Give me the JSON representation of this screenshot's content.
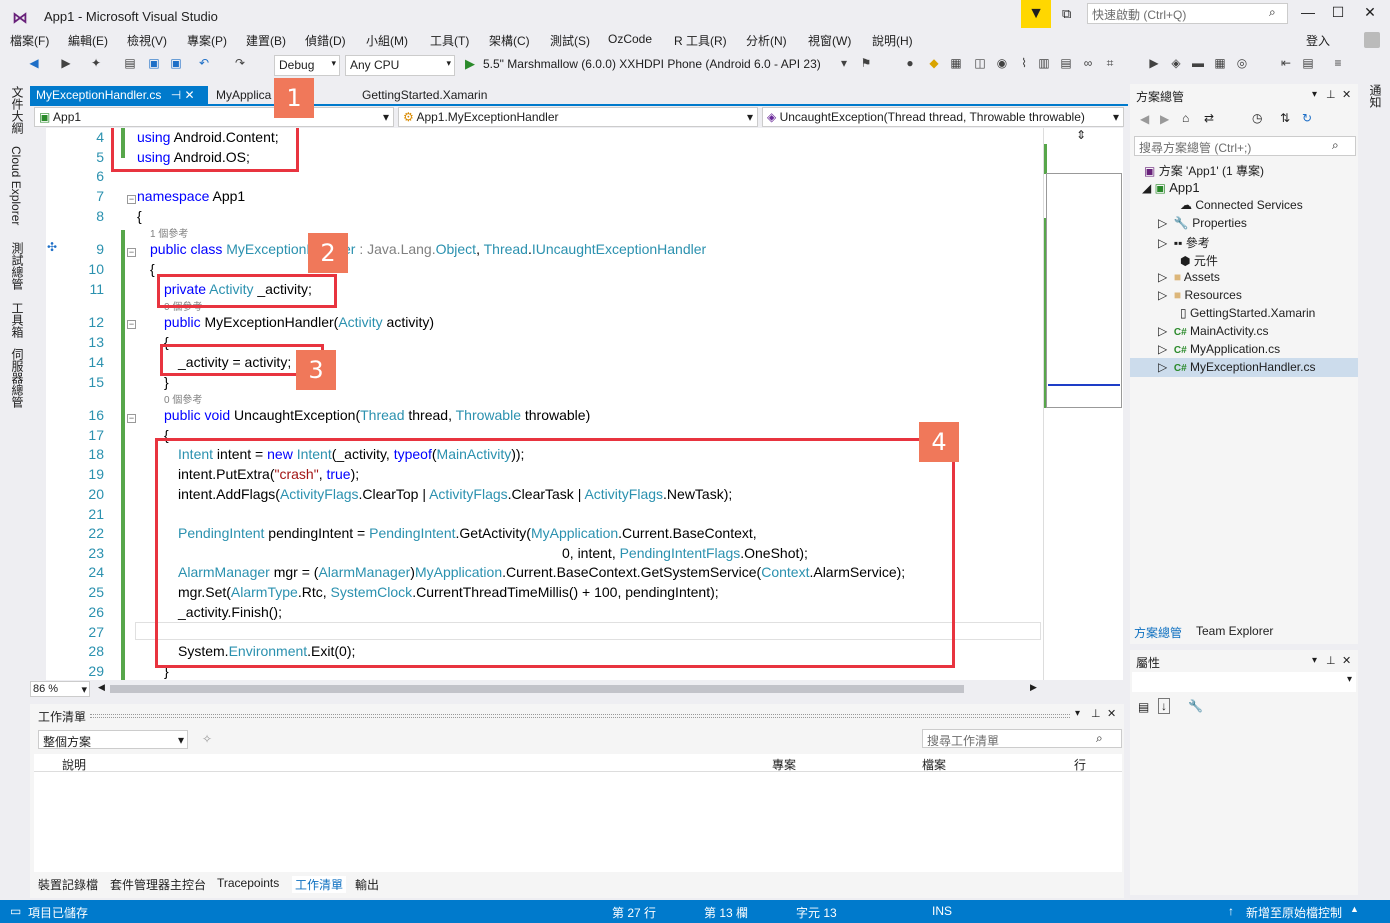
{
  "window": {
    "title": "App1 - Microsoft Visual Studio",
    "quick_launch": "快速啟動 (Ctrl+Q)",
    "sign_in": "登入"
  },
  "menu": [
    "檔案(F)",
    "編輯(E)",
    "檢視(V)",
    "專案(P)",
    "建置(B)",
    "偵錯(D)",
    "小組(M)",
    "工具(T)",
    "架構(C)",
    "測試(S)",
    "OzCode",
    "R 工具(R)",
    "分析(N)",
    "視窗(W)",
    "說明(H)"
  ],
  "toolbar": {
    "config": "Debug",
    "platform": "Any CPU",
    "run_target": "5.5\" Marshmallow (6.0.0) XXHDPI Phone (Android 6.0 - API 23)"
  },
  "left_tabs": [
    "文件大綱",
    "Cloud Explorer",
    "測試總管",
    "工具箱",
    "伺服器總管"
  ],
  "doc_tabs": [
    {
      "label": "MyExceptionHandler.cs",
      "active": true
    },
    {
      "label": "MyApplica",
      "active": false
    },
    {
      "label": "GettingStarted.Xamarin",
      "active": false
    }
  ],
  "nav": {
    "project": "App1",
    "class": "App1.MyExceptionHandler",
    "member": "UncaughtException(Thread thread, Throwable throwable)"
  },
  "refs": {
    "r1": "1 個參考",
    "r0": "0 個參考"
  },
  "code_lines": {
    "n4": "4",
    "n5": "5",
    "n6": "6",
    "n7": "7",
    "n8": "8",
    "n9": "9",
    "n10": "10",
    "n11": "11",
    "n12": "12",
    "n13": "13",
    "n14": "14",
    "n15": "15",
    "n16": "16",
    "n17": "17",
    "n18": "18",
    "n19": "19",
    "n20": "20",
    "n21": "21",
    "n22": "22",
    "n23": "23",
    "n24": "24",
    "n25": "25",
    "n26": "26",
    "n27": "27",
    "n28": "28",
    "n29": "29"
  },
  "code": {
    "l4a": "using",
    "l4b": " Android.Content;",
    "l5a": "using",
    "l5b": " Android.OS;",
    "l7a": "namespace",
    "l7b": " App1",
    "l8": "{",
    "l9a": "public class",
    "l9b": " MyExceptionHandler",
    "l9c": " : Java.Lang.",
    "l9d": "Object",
    ", ": "",
    "l9e": ", ",
    "l9f": "Thread",
    "l9g": ".",
    "l9h": "IUncaughtExceptionHandler",
    "l10": "{",
    "l11a": "private",
    "l11b": " Activity",
    "l11c": " _activity;",
    "l12a": "public",
    "l12b": " MyExceptionHandler(",
    "l12c": "Activity",
    "l12d": " activity)",
    "l13": "{",
    "l14": "_activity = activity;",
    "l15": "}",
    "l16a": "public void",
    "l16b": " UncaughtException(",
    "l16c": "Thread",
    "l16d": " thread, ",
    "l16e": "Throwable",
    "l16f": " throwable)",
    "l17": "{",
    "l18a": "Intent",
    "l18b": " intent = ",
    "l18c": "new",
    "l18d": " Intent",
    "l18e": "(_activity, ",
    "l18f": "typeof",
    "l18g": "(",
    "l18h": "MainActivity",
    "l18i": "));",
    "l19a": "intent.PutExtra(",
    "l19b": "\"crash\"",
    "l19c": ", ",
    "l19d": "true",
    "l19e": ");",
    "l20a": "intent.AddFlags(",
    "l20b": "ActivityFlags",
    "l20c": ".ClearTop | ",
    "l20d": "ActivityFlags",
    "l20e": ".ClearTask | ",
    "l20f": "ActivityFlags",
    "l20g": ".NewTask);",
    "l22a": "PendingIntent",
    "l22b": " pendingIntent = ",
    "l22c": "PendingIntent",
    "l22d": ".GetActivity(",
    "l22e": "MyApplication",
    "l22f": ".Current.BaseContext,",
    "l23a": "0, intent, ",
    "l23b": "PendingIntentFlags",
    "l23c": ".OneShot);",
    "l24a": "AlarmManager",
    "l24b": " mgr = (",
    "l24c": "AlarmManager",
    "l24d": ")",
    "l24e": "MyApplication",
    "l24f": ".Current.BaseContext.GetSystemService(",
    "l24g": "Context",
    "l24h": ".AlarmService);",
    "l25a": "mgr.Set(",
    "l25b": "AlarmType",
    "l25c": ".Rtc, ",
    "l25d": "SystemClock",
    "l25e": ".CurrentThreadTimeMillis() + 100, pendingIntent);",
    "l26": "_activity.Finish();",
    "l28a": "System.",
    "l28b": "Environment",
    "l28c": ".Exit(0);",
    "l29": "}"
  },
  "badges": [
    "1",
    "2",
    "3",
    "4"
  ],
  "zoom": "86 %",
  "solution": {
    "title": "方案總管",
    "search": "搜尋方案總管 (Ctrl+;)",
    "root": "方案 'App1' (1 專案)",
    "project": "App1",
    "items": [
      "Connected Services",
      "Properties",
      "參考",
      "元件",
      "Assets",
      "Resources",
      "GettingStarted.Xamarin",
      "MainActivity.cs",
      "MyApplication.cs",
      "MyExceptionHandler.cs"
    ],
    "tab1": "方案總管",
    "tab2": "Team Explorer"
  },
  "properties": {
    "title": "屬性"
  },
  "tasklist": {
    "title": "工作清單",
    "scope": "整個方案",
    "search": "搜尋工作清單",
    "cols": [
      "說明",
      "專案",
      "檔案",
      "行"
    ]
  },
  "bottom_tabs": [
    "裝置記錄檔",
    "套件管理器主控台",
    "Tracepoints",
    "工作清單",
    "輸出"
  ],
  "right_tab": "通知",
  "status": {
    "ready": "項目已儲存",
    "line": "第 27 行",
    "col": "第 13 欄",
    "ch": "字元 13",
    "ins": "INS",
    "publish": "新增至原始檔控制"
  }
}
